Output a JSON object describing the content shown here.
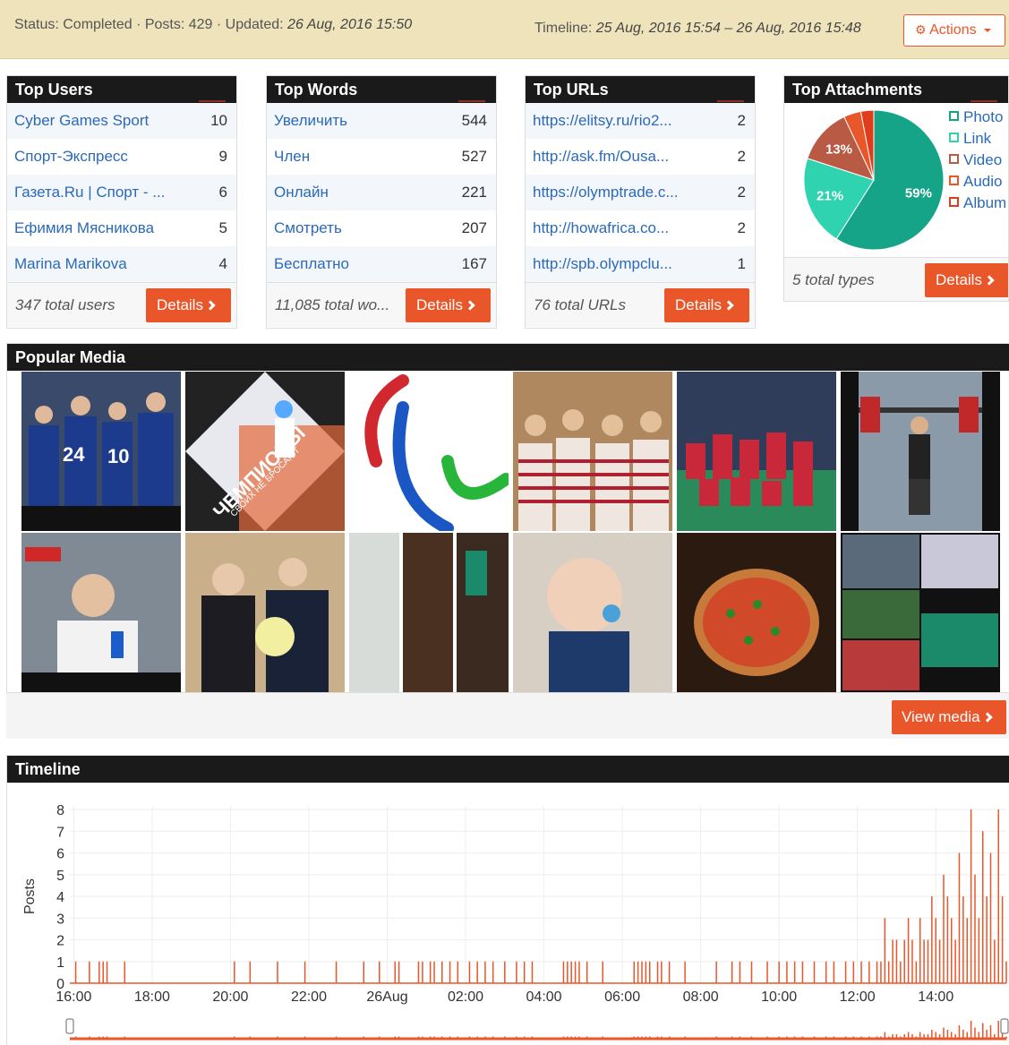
{
  "status": {
    "text": "Status: Completed · Posts: 429 · Updated: ",
    "updated": "26 Aug, 2016 15:50",
    "timeline_label": "Timeline: ",
    "timeline_range": "25 Aug, 2016 15:54 – 26 Aug, 2016 15:48",
    "actions_label": "Actions",
    "actions_icon": "gear-icon"
  },
  "top_users": {
    "title": "Top Users",
    "rows": [
      {
        "label": "Cyber Games Sport",
        "count": "10"
      },
      {
        "label": "Спорт-Экспресс",
        "count": "9"
      },
      {
        "label": "Газета.Ru | Спорт - ...",
        "count": "6"
      },
      {
        "label": "Ефимия Мясникова",
        "count": "5"
      },
      {
        "label": "Marina Marikova",
        "count": "4"
      }
    ],
    "footer": "347 total users",
    "details": "Details"
  },
  "top_words": {
    "title": "Top Words",
    "rows": [
      {
        "label": "Увеличить",
        "count": "544"
      },
      {
        "label": "Член",
        "count": "527"
      },
      {
        "label": "Онлайн",
        "count": "221"
      },
      {
        "label": "Смотреть",
        "count": "207"
      },
      {
        "label": "Бесплатно",
        "count": "167"
      }
    ],
    "footer": "11,085 total wo...",
    "details": "Details"
  },
  "top_urls": {
    "title": "Top URLs",
    "rows": [
      {
        "label": "https://elitsy.ru/rio2...",
        "count": "2"
      },
      {
        "label": "http://ask.fm/Ousa...",
        "count": "2"
      },
      {
        "label": "https://olymptrade.c...",
        "count": "2"
      },
      {
        "label": "http://howafrica.co...",
        "count": "2"
      },
      {
        "label": "http://spb.olympclu...",
        "count": "1"
      }
    ],
    "footer": "76 total URLs",
    "details": "Details"
  },
  "top_attachments": {
    "title": "Top Attachments",
    "footer": "5 total types",
    "details": "Details",
    "legend": [
      {
        "label": "Photo",
        "color": "#15a488"
      },
      {
        "label": "Link",
        "color": "#2fd3b0"
      },
      {
        "label": "Video",
        "color": "#b85a44"
      },
      {
        "label": "Audio",
        "color": "#e8562a"
      },
      {
        "label": "Album",
        "color": "#e03c1c"
      }
    ],
    "pie": [
      {
        "label": "59%",
        "value": 59,
        "color": "#15a488"
      },
      {
        "label": "21%",
        "value": 21,
        "color": "#2fd3b0"
      },
      {
        "label": "13%",
        "value": 13,
        "color": "#b85a44"
      },
      {
        "label": "",
        "value": 4,
        "color": "#e8562a"
      },
      {
        "label": "",
        "value": 3,
        "color": "#e03c1c"
      }
    ]
  },
  "media": {
    "title": "Popular Media",
    "view_label": "View media",
    "tiles": [
      {
        "name": "media-hockey-team",
        "bg": "#2b3d6b"
      },
      {
        "name": "media-handball-champions",
        "bg": "#ddd"
      },
      {
        "name": "media-paralympic-logo",
        "bg": "#fff"
      },
      {
        "name": "media-girls-group",
        "bg": "#8a5a3a"
      },
      {
        "name": "media-team-celebration",
        "bg": "#2a6b3d"
      },
      {
        "name": "media-weightlifter",
        "bg": "#333"
      },
      {
        "name": "media-reporter",
        "bg": "#6e7a88"
      },
      {
        "name": "media-putin-flowers",
        "bg": "#c5a67c"
      },
      {
        "name": "media-horses",
        "bg": "#5a4030"
      },
      {
        "name": "media-baby",
        "bg": "#e6dccf"
      },
      {
        "name": "media-pizza",
        "bg": "#3a2418"
      },
      {
        "name": "media-collage",
        "bg": "#222"
      }
    ],
    "tile_texts": {
      "champions": "ЧЕМПИОНЫ",
      "champions_sub": "СВОИХ НЕ БРОСАЮТ"
    }
  },
  "timeline": {
    "title": "Timeline",
    "ylabel": "Posts",
    "y_ticks": [
      "8",
      "7",
      "6",
      "5",
      "4",
      "3",
      "2",
      "1",
      "0"
    ],
    "x_ticks": [
      "16:00",
      "18:00",
      "20:00",
      "22:00",
      "26Aug",
      "02:00",
      "04:00",
      "06:00",
      "08:00",
      "10:00",
      "12:00",
      "14:00"
    ]
  },
  "chart_data": {
    "type": "line",
    "title": "",
    "xlabel": "",
    "ylabel": "Posts",
    "ylim": [
      0,
      8
    ],
    "x_ticks": [
      "16:00",
      "18:00",
      "20:00",
      "22:00",
      "26Aug",
      "02:00",
      "04:00",
      "06:00",
      "08:00",
      "10:00",
      "12:00",
      "14:00"
    ],
    "series": [
      {
        "name": "",
        "color": "#e8562a",
        "x_hours_since_15_54": [
          0.15,
          0.5,
          0.75,
          0.85,
          0.95,
          1.4,
          4.2,
          4.6,
          5.3,
          6.0,
          6.8,
          7.5,
          7.9,
          8.3,
          8.4,
          8.9,
          9.0,
          9.2,
          9.3,
          9.5,
          9.7,
          9.9,
          10.2,
          10.4,
          10.6,
          10.8,
          11.1,
          11.4,
          11.6,
          11.8,
          12.6,
          12.7,
          12.8,
          12.9,
          13.0,
          13.2,
          13.6,
          14.4,
          14.5,
          14.6,
          14.7,
          14.8,
          15.0,
          15.1,
          15.3,
          15.7,
          16.5,
          16.9,
          17.1,
          17.4,
          17.8,
          18.1,
          18.3,
          18.5,
          18.7,
          19.0,
          19.3,
          19.5,
          19.8,
          20.0,
          20.2,
          20.4,
          20.6,
          20.7,
          20.8,
          20.9,
          21.0,
          21.1,
          21.2,
          21.3,
          21.4,
          21.5,
          21.6,
          21.7,
          21.8,
          21.9,
          22.0,
          22.1,
          22.2,
          22.3,
          22.4,
          22.5,
          22.6,
          22.7,
          22.8,
          22.9,
          23.0,
          23.1,
          23.2,
          23.3,
          23.4,
          23.5,
          23.6,
          23.7,
          23.8,
          23.9
        ],
        "y": [
          1,
          1,
          1,
          1,
          1,
          1,
          1,
          1,
          1,
          1,
          1,
          1,
          1,
          1,
          1,
          1,
          1,
          1,
          1,
          1,
          1,
          1,
          1,
          1,
          1,
          1,
          1,
          1,
          1,
          1,
          1,
          1,
          1,
          1,
          1,
          1,
          1,
          1,
          1,
          1,
          1,
          1,
          1,
          1,
          1,
          1,
          1,
          1,
          1,
          1,
          1,
          1,
          1,
          1,
          1,
          1,
          1,
          1,
          1,
          1,
          1,
          1,
          1,
          1,
          3,
          1,
          2,
          2,
          1,
          2,
          3,
          2,
          1,
          3,
          2,
          2,
          4,
          3,
          2,
          5,
          4,
          3,
          2,
          6,
          4,
          3,
          8,
          5,
          3,
          7,
          4,
          6,
          2,
          8,
          4,
          1
        ]
      }
    ]
  }
}
